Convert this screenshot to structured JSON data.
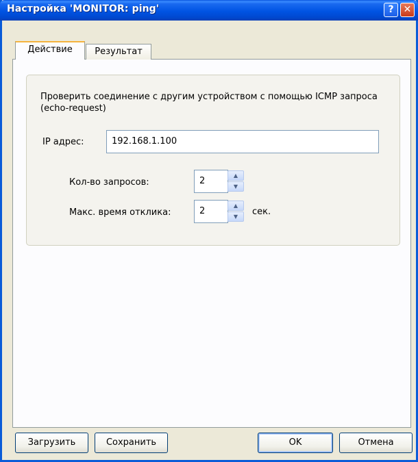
{
  "window": {
    "title": "Настройка 'MONITOR: ping'",
    "help_glyph": "?",
    "close_glyph": "✕"
  },
  "tabs": [
    {
      "label": "Действие",
      "active": true
    },
    {
      "label": "Результат",
      "active": false
    }
  ],
  "action": {
    "description": "Проверить соединение  с другим устройством с помощью ICMP запроса (echo-request)",
    "ip_label": "IP адрес:",
    "ip_value": "192.168.1.100",
    "requests_label": "Кол-во запросов:",
    "requests_value": "2",
    "timeout_label": "Макс. время отклика:",
    "timeout_value": "2",
    "timeout_unit": "сек."
  },
  "spin_up_glyph": "▲",
  "spin_down_glyph": "▼",
  "buttons": {
    "load": "Загрузить",
    "save": "Сохранить",
    "ok": "OK",
    "cancel": "Отмена"
  }
}
